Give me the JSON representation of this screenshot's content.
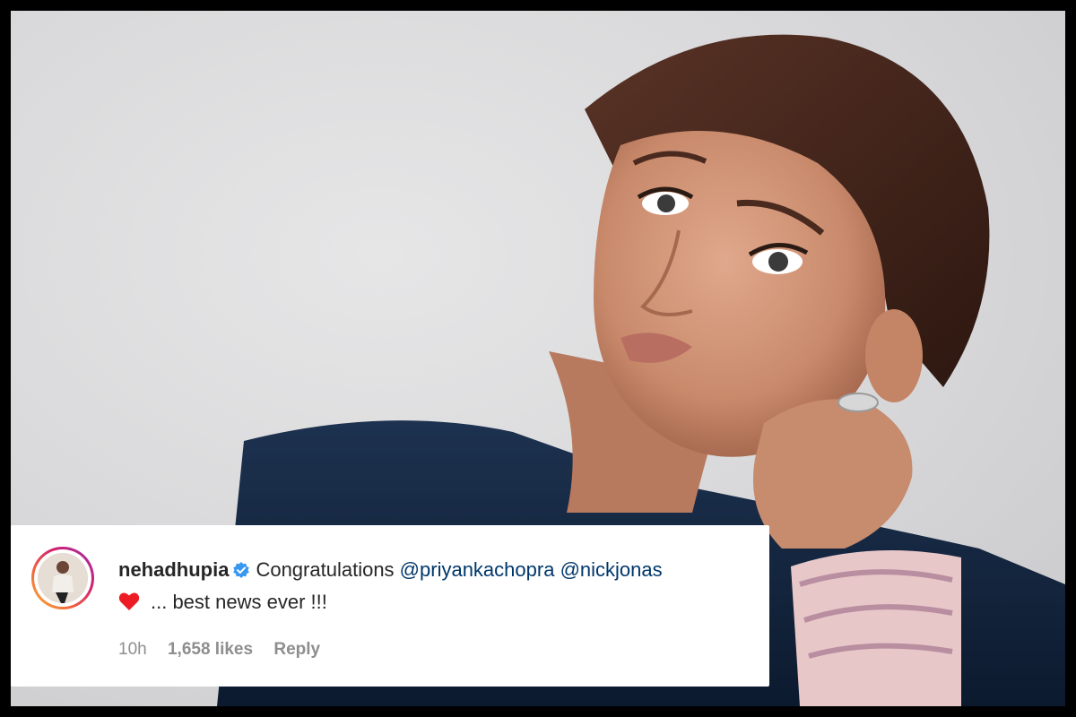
{
  "photo": {
    "description_icon": "portrait-photo"
  },
  "comment": {
    "username": "nehadhupia",
    "verified_icon": "verified-badge-icon",
    "text": "Congratulations ",
    "mentions": [
      "@priyankachopra",
      "@nickjonas"
    ],
    "emoji_icon": "red-heart-icon",
    "text2": "... best news ever !!!",
    "time": "10h",
    "likes": "1,658 likes",
    "reply_label": "Reply"
  },
  "colors": {
    "mention": "#00376b",
    "heart": "#ed1c24",
    "verified": "#3897f0",
    "meta": "#8e8e8e"
  }
}
